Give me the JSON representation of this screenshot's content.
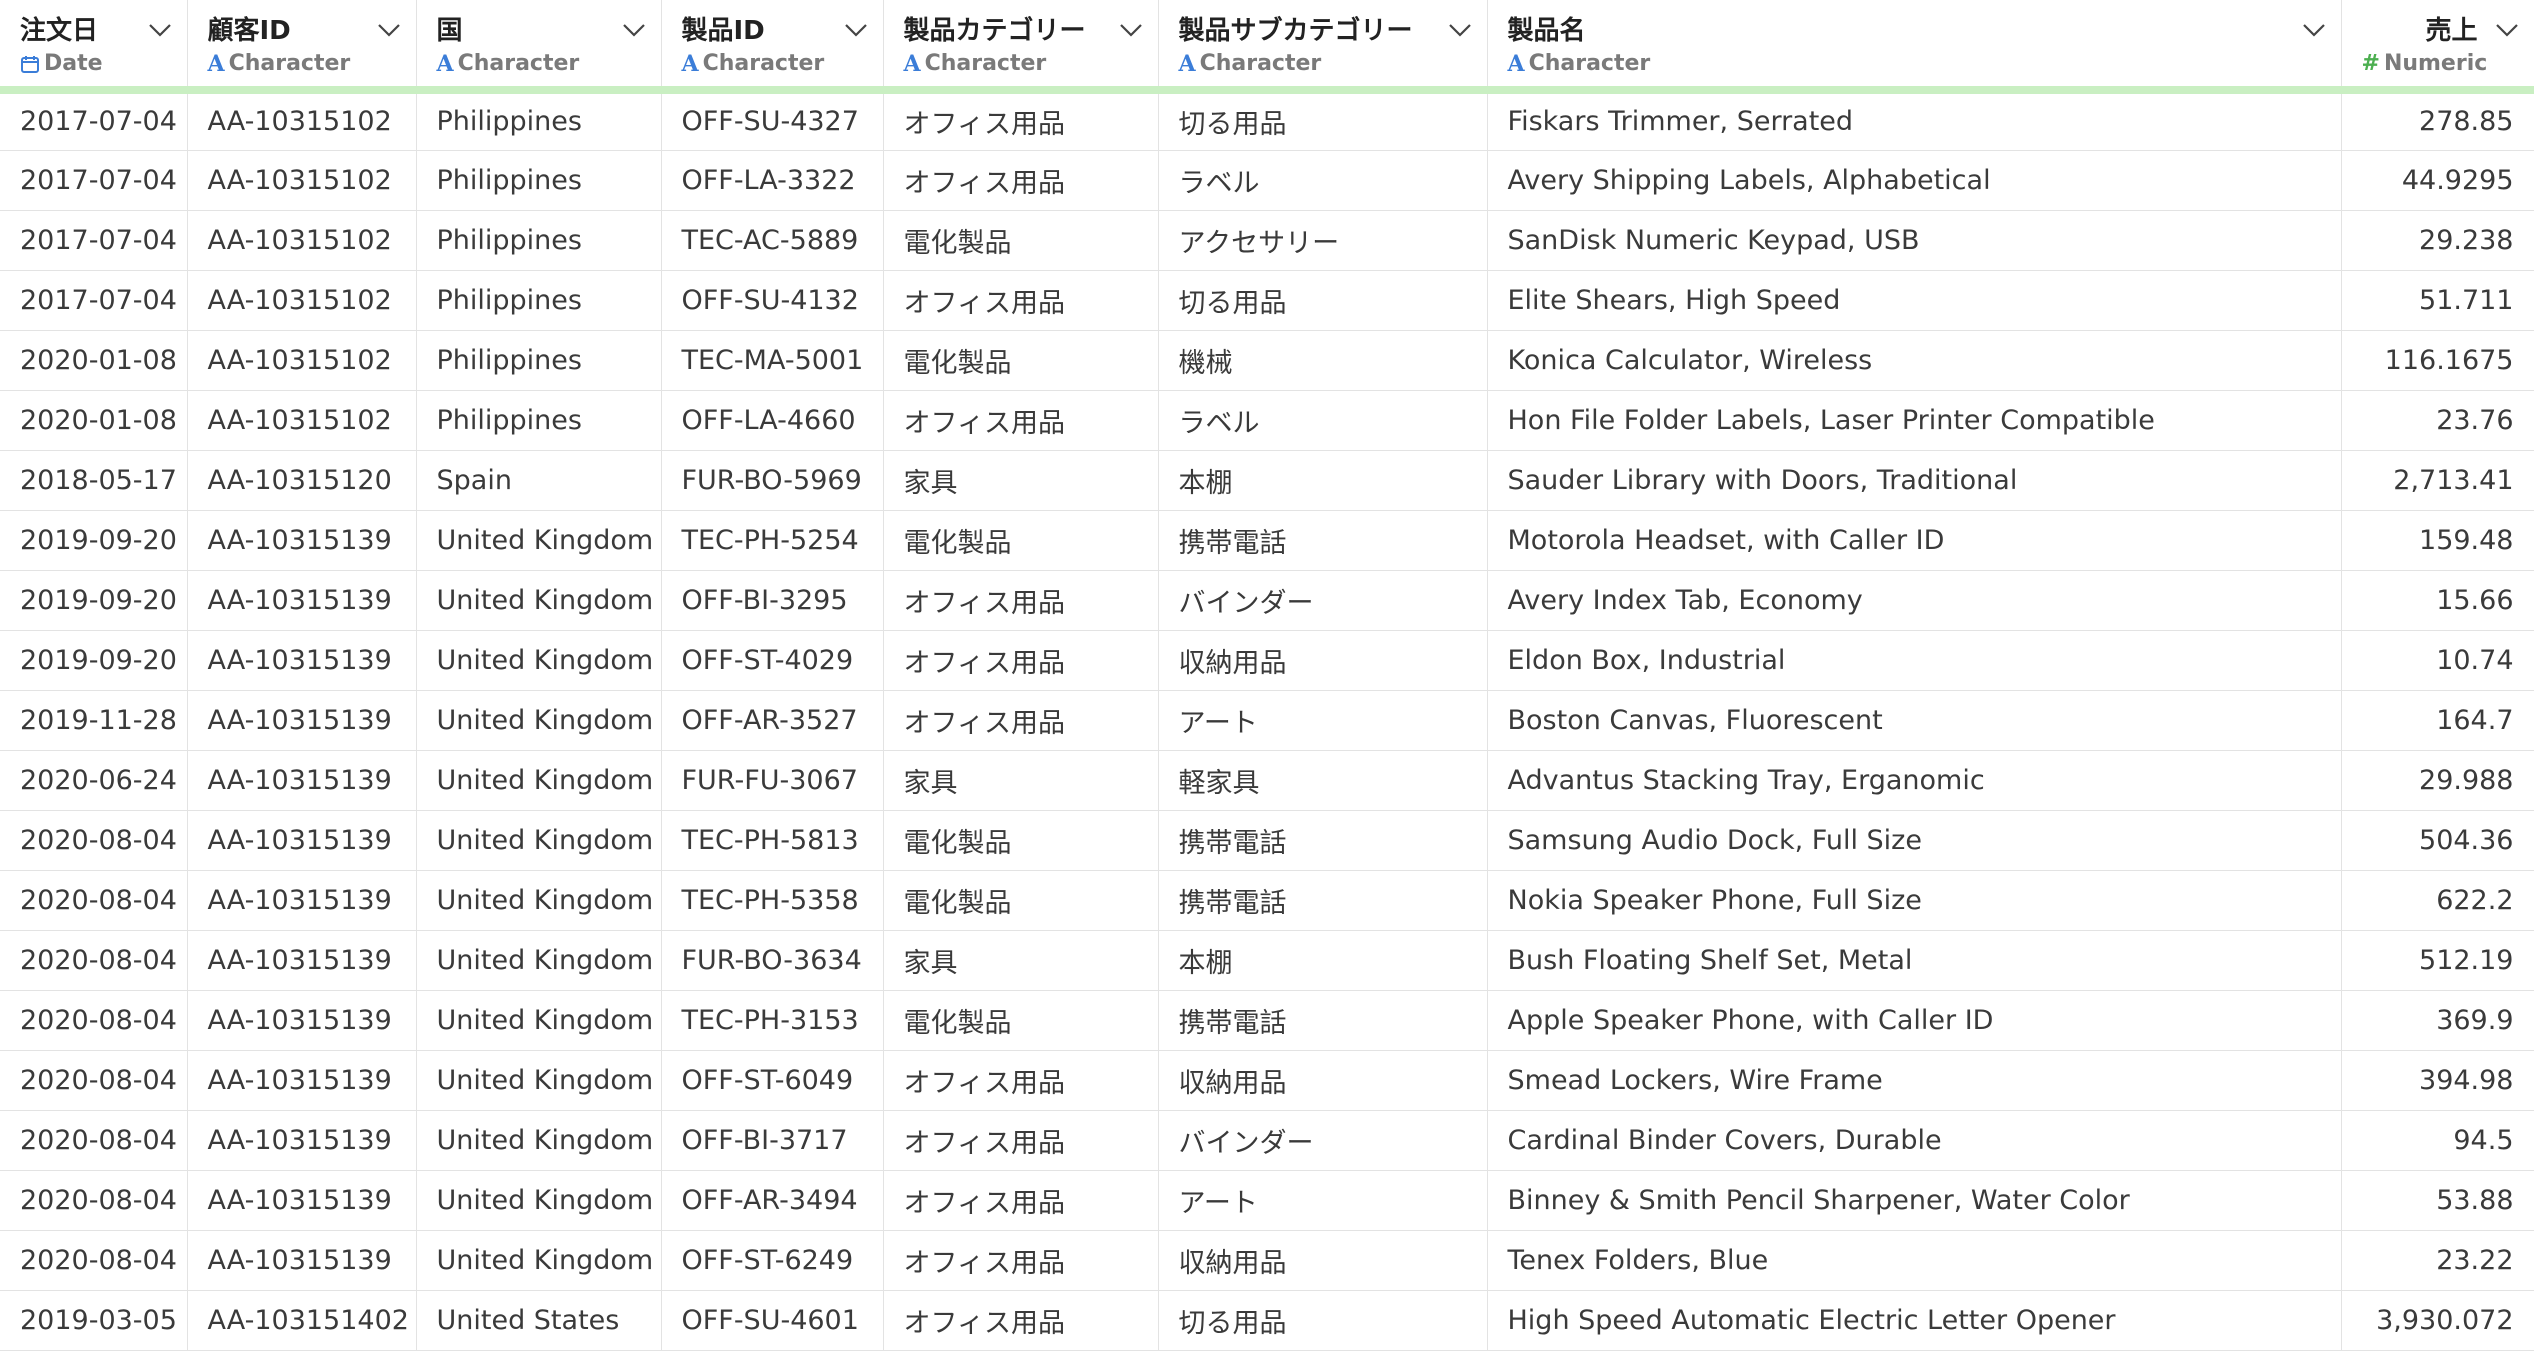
{
  "columns": [
    {
      "name": "注文日",
      "type": "Date",
      "icon": "calendar-icon",
      "numeric": false
    },
    {
      "name": "顧客ID",
      "type": "Character",
      "icon": "character-type-icon",
      "numeric": false
    },
    {
      "name": "国",
      "type": "Character",
      "icon": "character-type-icon",
      "numeric": false
    },
    {
      "name": "製品ID",
      "type": "Character",
      "icon": "character-type-icon",
      "numeric": false
    },
    {
      "name": "製品カテゴリー",
      "type": "Character",
      "icon": "character-type-icon",
      "numeric": false
    },
    {
      "name": "製品サブカテゴリー",
      "type": "Character",
      "icon": "character-type-icon",
      "numeric": false
    },
    {
      "name": "製品名",
      "type": "Character",
      "icon": "character-type-icon",
      "numeric": false
    },
    {
      "name": "売上",
      "type": "Numeric",
      "icon": "numeric-type-icon",
      "numeric": true
    }
  ],
  "colors": {
    "header_accent": "#c9efc2",
    "character_icon": "#3b7dd8",
    "numeric_icon": "#4caf50",
    "date_icon": "#3b7dd8"
  },
  "rows": [
    [
      "2017-07-04",
      "AA-10315102",
      "Philippines",
      "OFF-SU-4327",
      "オフィス用品",
      "切る用品",
      "Fiskars Trimmer, Serrated",
      "278.85"
    ],
    [
      "2017-07-04",
      "AA-10315102",
      "Philippines",
      "OFF-LA-3322",
      "オフィス用品",
      "ラベル",
      "Avery Shipping Labels, Alphabetical",
      "44.9295"
    ],
    [
      "2017-07-04",
      "AA-10315102",
      "Philippines",
      "TEC-AC-5889",
      "電化製品",
      "アクセサリー",
      "SanDisk Numeric Keypad, USB",
      "29.238"
    ],
    [
      "2017-07-04",
      "AA-10315102",
      "Philippines",
      "OFF-SU-4132",
      "オフィス用品",
      "切る用品",
      "Elite Shears, High Speed",
      "51.711"
    ],
    [
      "2020-01-08",
      "AA-10315102",
      "Philippines",
      "TEC-MA-5001",
      "電化製品",
      "機械",
      "Konica Calculator, Wireless",
      "116.1675"
    ],
    [
      "2020-01-08",
      "AA-10315102",
      "Philippines",
      "OFF-LA-4660",
      "オフィス用品",
      "ラベル",
      "Hon File Folder Labels, Laser Printer Compatible",
      "23.76"
    ],
    [
      "2018-05-17",
      "AA-10315120",
      "Spain",
      "FUR-BO-5969",
      "家具",
      "本棚",
      "Sauder Library with Doors, Traditional",
      "2,713.41"
    ],
    [
      "2019-09-20",
      "AA-10315139",
      "United Kingdom",
      "TEC-PH-5254",
      "電化製品",
      "携帯電話",
      "Motorola Headset, with Caller ID",
      "159.48"
    ],
    [
      "2019-09-20",
      "AA-10315139",
      "United Kingdom",
      "OFF-BI-3295",
      "オフィス用品",
      "バインダー",
      "Avery Index Tab, Economy",
      "15.66"
    ],
    [
      "2019-09-20",
      "AA-10315139",
      "United Kingdom",
      "OFF-ST-4029",
      "オフィス用品",
      "収納用品",
      "Eldon Box, Industrial",
      "10.74"
    ],
    [
      "2019-11-28",
      "AA-10315139",
      "United Kingdom",
      "OFF-AR-3527",
      "オフィス用品",
      "アート",
      "Boston Canvas, Fluorescent",
      "164.7"
    ],
    [
      "2020-06-24",
      "AA-10315139",
      "United Kingdom",
      "FUR-FU-3067",
      "家具",
      "軽家具",
      "Advantus Stacking Tray, Erganomic",
      "29.988"
    ],
    [
      "2020-08-04",
      "AA-10315139",
      "United Kingdom",
      "TEC-PH-5813",
      "電化製品",
      "携帯電話",
      "Samsung Audio Dock, Full Size",
      "504.36"
    ],
    [
      "2020-08-04",
      "AA-10315139",
      "United Kingdom",
      "TEC-PH-5358",
      "電化製品",
      "携帯電話",
      "Nokia Speaker Phone, Full Size",
      "622.2"
    ],
    [
      "2020-08-04",
      "AA-10315139",
      "United Kingdom",
      "FUR-BO-3634",
      "家具",
      "本棚",
      "Bush Floating Shelf Set, Metal",
      "512.19"
    ],
    [
      "2020-08-04",
      "AA-10315139",
      "United Kingdom",
      "TEC-PH-3153",
      "電化製品",
      "携帯電話",
      "Apple Speaker Phone, with Caller ID",
      "369.9"
    ],
    [
      "2020-08-04",
      "AA-10315139",
      "United Kingdom",
      "OFF-ST-6049",
      "オフィス用品",
      "収納用品",
      "Smead Lockers, Wire Frame",
      "394.98"
    ],
    [
      "2020-08-04",
      "AA-10315139",
      "United Kingdom",
      "OFF-BI-3717",
      "オフィス用品",
      "バインダー",
      "Cardinal Binder Covers, Durable",
      "94.5"
    ],
    [
      "2020-08-04",
      "AA-10315139",
      "United Kingdom",
      "OFF-AR-3494",
      "オフィス用品",
      "アート",
      "Binney & Smith Pencil Sharpener, Water Color",
      "53.88"
    ],
    [
      "2020-08-04",
      "AA-10315139",
      "United Kingdom",
      "OFF-ST-6249",
      "オフィス用品",
      "収納用品",
      "Tenex Folders, Blue",
      "23.22"
    ],
    [
      "2019-03-05",
      "AA-103151402",
      "United States",
      "OFF-SU-4601",
      "オフィス用品",
      "切る用品",
      "High Speed Automatic Electric Letter Opener",
      "3,930.072"
    ]
  ]
}
